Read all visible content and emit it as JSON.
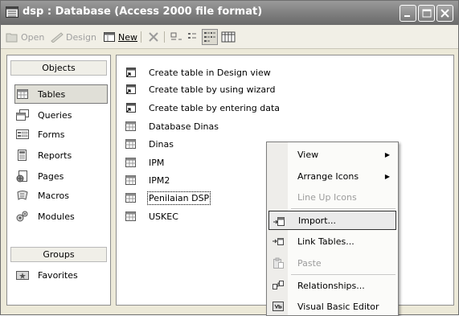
{
  "window": {
    "title": "dsp : Database (Access 2000 file format)"
  },
  "toolbar": {
    "open_label": "Open",
    "design_label": "Design",
    "new_label": "New"
  },
  "objects_bar": {
    "objects_header": "Objects",
    "groups_header": "Groups",
    "items": [
      {
        "label": "Tables",
        "icon": "table-icon",
        "selected": true
      },
      {
        "label": "Queries",
        "icon": "query-icon"
      },
      {
        "label": "Forms",
        "icon": "form-icon"
      },
      {
        "label": "Reports",
        "icon": "report-icon"
      },
      {
        "label": "Pages",
        "icon": "page-icon"
      },
      {
        "label": "Macros",
        "icon": "macro-icon"
      },
      {
        "label": "Modules",
        "icon": "module-icon"
      }
    ],
    "groups": [
      {
        "label": "Favorites",
        "icon": "favorites-folder-icon"
      }
    ]
  },
  "list": {
    "items": [
      {
        "label": "Create table in Design view",
        "icon": "shortcut-icon"
      },
      {
        "label": "Create table by using wizard",
        "icon": "shortcut-icon"
      },
      {
        "label": "Create table by entering data",
        "icon": "shortcut-icon"
      },
      {
        "label": "Database Dinas",
        "icon": "table-icon"
      },
      {
        "label": "Dinas",
        "icon": "table-icon"
      },
      {
        "label": "IPM",
        "icon": "table-icon"
      },
      {
        "label": "IPM2",
        "icon": "table-icon"
      },
      {
        "label": "Penilaian DSP",
        "icon": "table-icon",
        "focused": true
      },
      {
        "label": "USKEC",
        "icon": "table-icon"
      }
    ]
  },
  "context_menu": {
    "items": [
      {
        "label": "View",
        "has_submenu": true
      },
      {
        "label": "Arrange Icons",
        "has_submenu": true
      },
      {
        "label": "Line Up Icons",
        "disabled": true
      },
      {
        "label": "Import...",
        "highlighted": true,
        "icon": "import-icon"
      },
      {
        "label": "Link Tables...",
        "icon": "link-tables-icon"
      },
      {
        "label": "Paste",
        "disabled": true,
        "icon": "paste-icon"
      },
      {
        "label": "Relationships...",
        "icon": "relationships-icon"
      },
      {
        "label": "Visual Basic Editor",
        "icon": "vb-editor-icon"
      }
    ]
  }
}
